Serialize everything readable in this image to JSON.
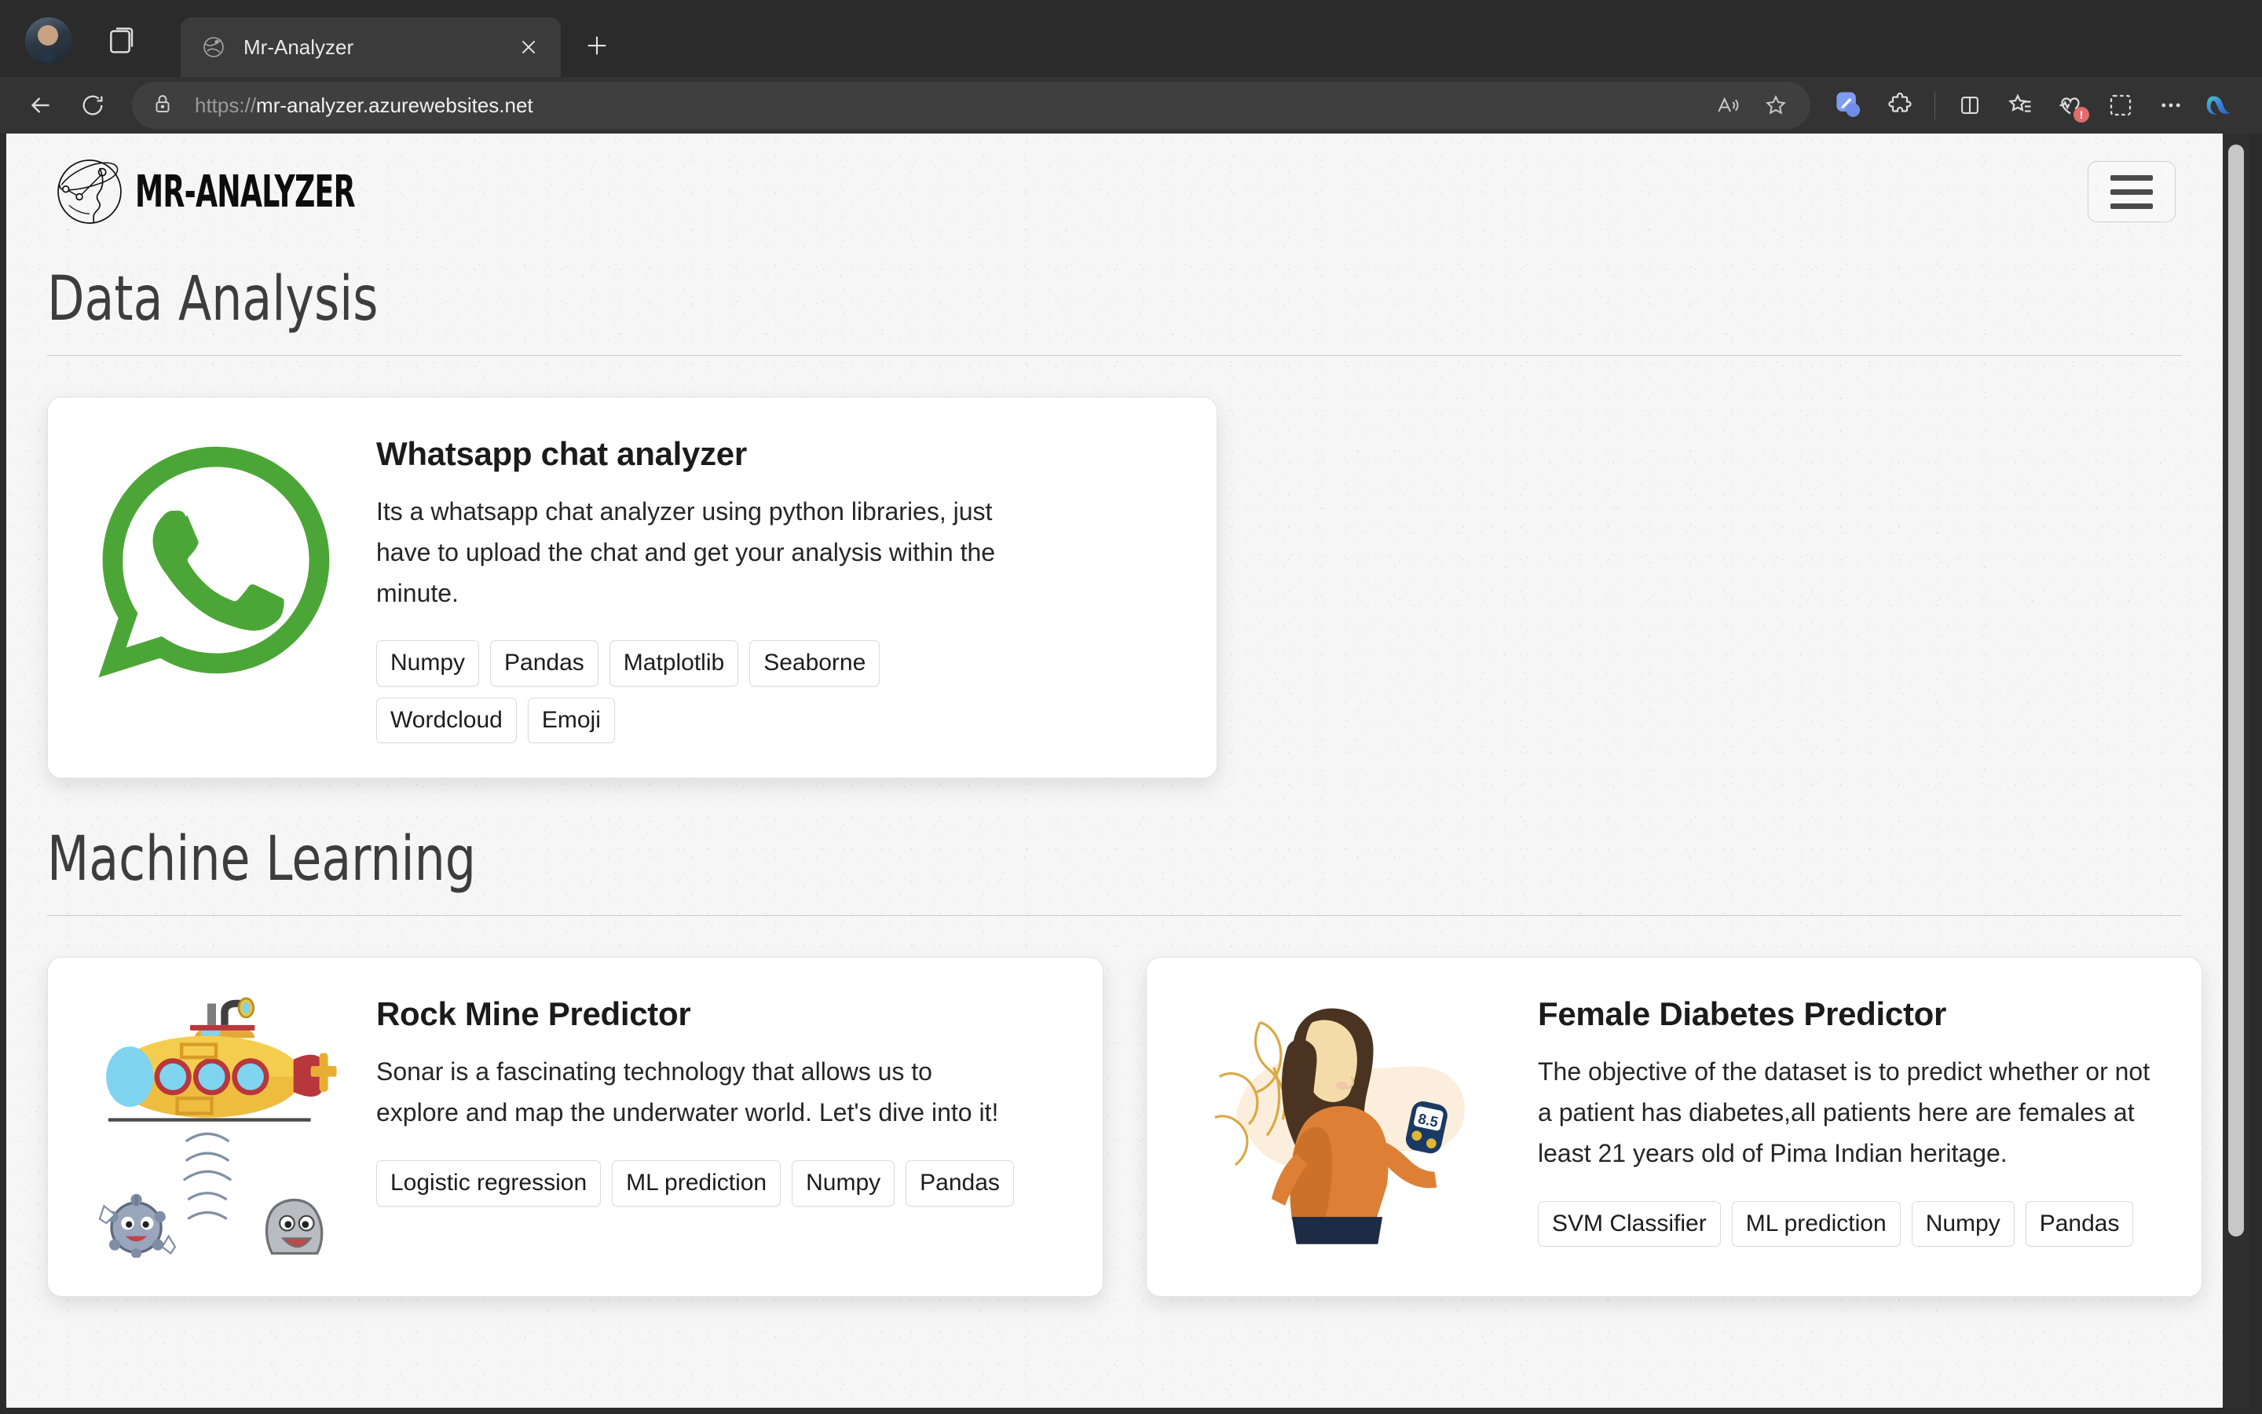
{
  "browser": {
    "tab": {
      "title": "Mr-Analyzer",
      "favicon_icon": "globe-sketch-icon",
      "close_icon": "close-icon"
    },
    "new_tab_icon": "plus-icon",
    "collections_icon": "collections-icon",
    "avatar_icon": "profile-avatar",
    "back_icon": "back-arrow-icon",
    "reload_icon": "reload-icon",
    "lock_icon": "lock-icon",
    "url_scheme": "https://",
    "url_host": "mr-analyzer.azurewebsites.net",
    "url_full": "https://mr-analyzer.azurewebsites.net",
    "omnibox_actions": [
      {
        "name": "read-aloud-icon",
        "glyph": "A"
      },
      {
        "name": "favorite-star-icon",
        "glyph": "star"
      }
    ],
    "toolbar_icons": [
      {
        "name": "copilot-pen-icon"
      },
      {
        "name": "extensions-puzzle-icon"
      },
      {
        "name": "split-screen-icon"
      },
      {
        "name": "favorites-list-icon"
      },
      {
        "name": "browser-essentials-icon",
        "badge": "!"
      },
      {
        "name": "screenshot-capture-icon"
      },
      {
        "name": "settings-more-icon"
      },
      {
        "name": "copilot-icon"
      }
    ]
  },
  "site": {
    "brand_name": "MR-ANALYZER",
    "brand_logo_icon": "head-network-logo",
    "menu_toggle_icon": "hamburger-menu-icon"
  },
  "sections": [
    {
      "title": "Data Analysis",
      "cards": [
        {
          "title": "Whatsapp chat analyzer",
          "description": "Its a whatsapp chat analyzer using python libraries, just have to upload the chat and get your analysis within the minute.",
          "image_icon": "whatsapp-logo",
          "tags": [
            "Numpy",
            "Pandas",
            "Matplotlib",
            "Seaborne",
            "Wordcloud",
            "Emoji"
          ]
        }
      ]
    },
    {
      "title": "Machine Learning",
      "cards": [
        {
          "title": "Rock Mine Predictor",
          "description": "Sonar is a fascinating technology that allows us to explore and map the underwater world. Let's dive into it!",
          "image_icon": "submarine-sonar-illustration",
          "tags": [
            "Logistic regression",
            "ML prediction",
            "Numpy",
            "Pandas"
          ]
        },
        {
          "title": "Female Diabetes Predictor",
          "description": "The objective of the dataset is to predict whether or not a patient has diabetes,all patients here are females at least 21 years old of Pima Indian heritage.",
          "image_icon": "woman-glucose-meter-illustration",
          "glucose_reading": "8.5",
          "tags": [
            "SVM Classifier",
            "ML prediction",
            "Numpy",
            "Pandas"
          ]
        }
      ]
    }
  ],
  "colors": {
    "whatsapp_green": "#4CA637",
    "sweater_orange": "#DD8036",
    "submarine_yellow": "#F5C842",
    "page_bg": "#F6F6F6",
    "chrome_bg": "#2B2B2B"
  }
}
